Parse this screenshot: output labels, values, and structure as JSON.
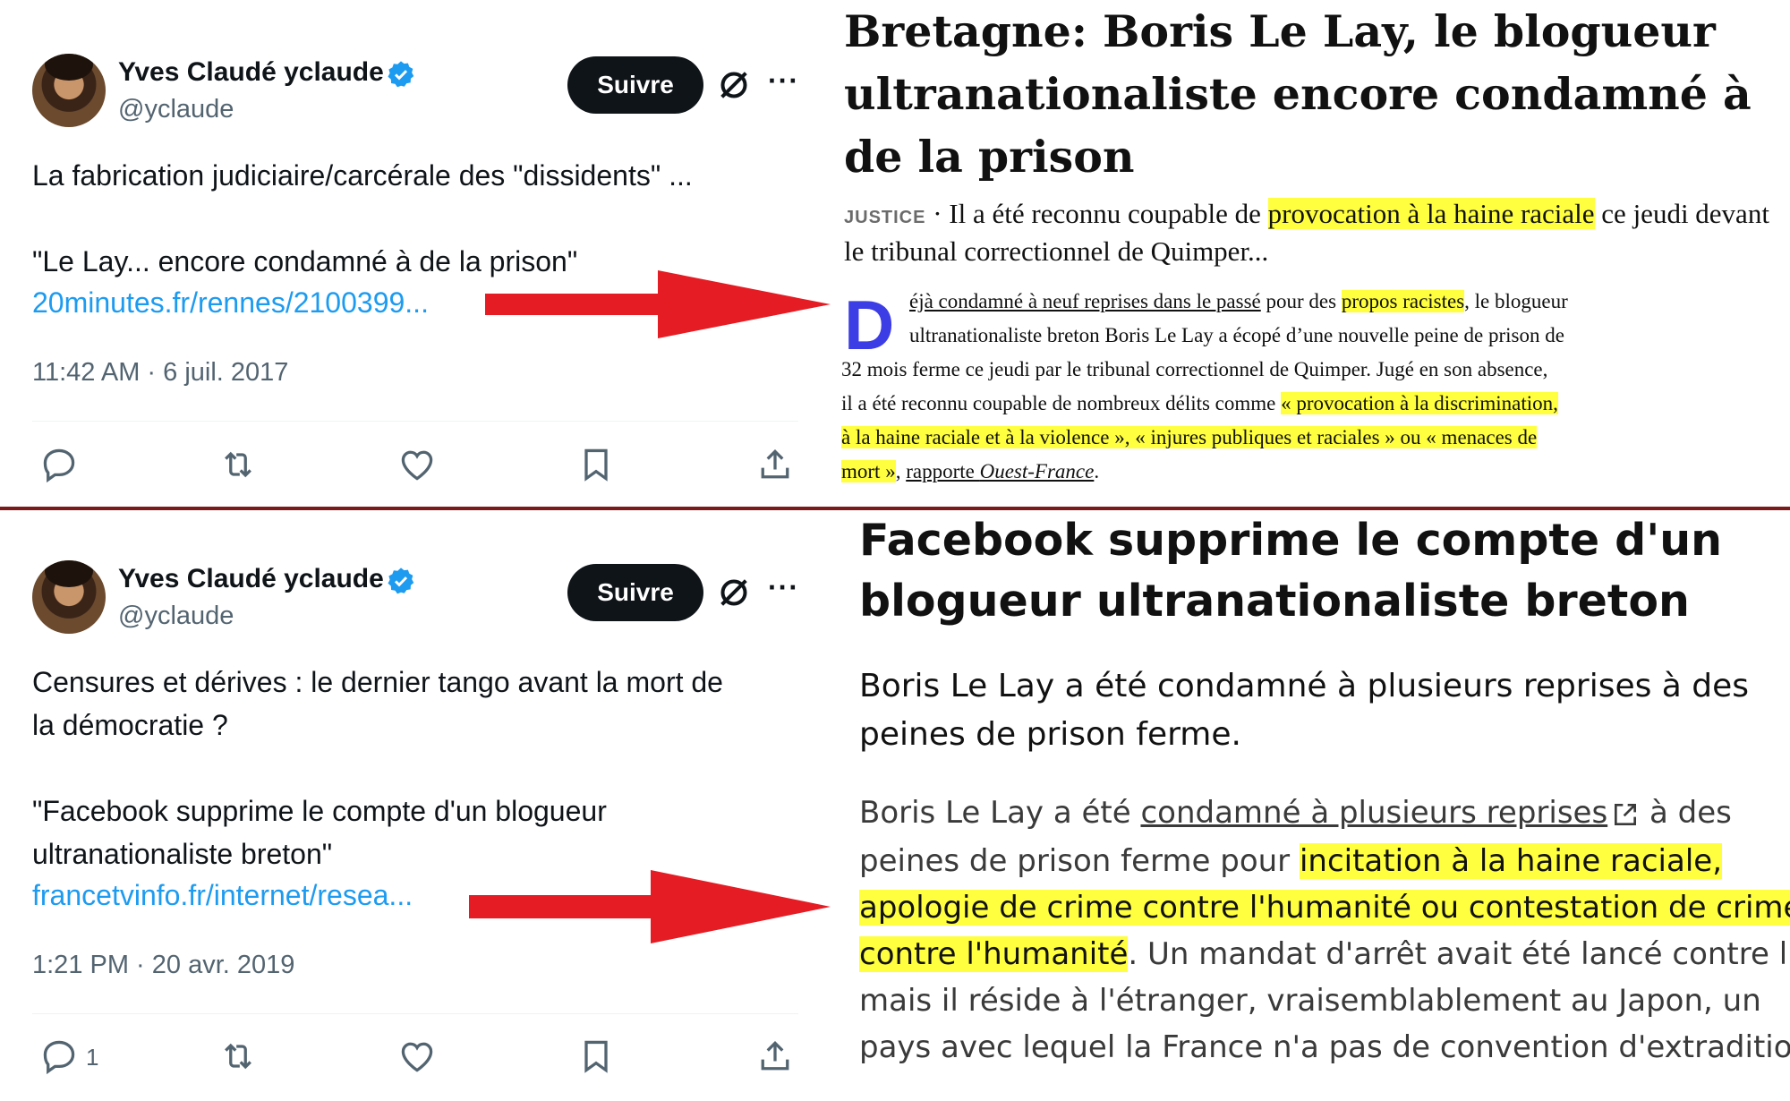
{
  "tweets": [
    {
      "name": "Yves Claudé yclaude",
      "handle": "@yclaude",
      "follow_label": "Suivre",
      "text": "La fabrication judiciaire/carcérale des \"dissidents\" ...\n\n\"Le Lay... encore condamné à de la prison\"",
      "link": "20minutes.fr/rennes/2100399...",
      "date": "11:42 AM · 6 juil. 2017",
      "reply_count": ""
    },
    {
      "name": "Yves Claudé yclaude",
      "handle": "@yclaude",
      "follow_label": "Suivre",
      "text": "Censures et dérives : le dernier tango avant la mort de\nla démocratie ?\n\n\"Facebook supprime le compte d'un blogueur\nultranationaliste breton\"",
      "link": "francetvinfo.fr/internet/resea...",
      "date": "1:21 PM · 20 avr. 2019",
      "reply_count": "1"
    }
  ],
  "article1": {
    "title": "Bretagne: Boris Le Lay, le blogueur ultranationaliste encore condamné à de la prison",
    "rubric": "JUSTICE",
    "chapo_before": " · Il a été reconnu coupable de ",
    "chapo_highlight": "provocation à la haine raciale",
    "chapo_after": " ce jeudi devant le tribunal correctionnel de Quimper...",
    "dropcap": "D",
    "l1_link": "éjà condamné à neuf reprises dans le passé",
    "l1_mid": " pour des ",
    "l1_hl": "propos racistes",
    "l1_end": ", le blogueur",
    "l2": "ultranationaliste breton Boris Le Lay a écopé d’une nouvelle peine de prison de",
    "l3": "32 mois ferme ce jeudi par le tribunal correctionnel de Quimper. Jugé en son absence,",
    "l4_start": "il a été reconnu coupable de nombreux délits comme ",
    "l4_hl": "« provocation à la discrimination,",
    "l5_hl": "à la haine raciale et à la violence », « injures publiques et raciales » ou « menaces de",
    "l6_hl": "mort »",
    "l6_sep": ", ",
    "l6_link": "rapporte ",
    "l6_source": "Ouest-France",
    "l6_end": "."
  },
  "article2": {
    "title": "Facebook supprime le compte d'un blogueur ultranationaliste breton",
    "chapo": "Boris Le Lay a été condamné à plusieurs reprises à des peines de prison ferme.",
    "l1_start": "Boris Le Lay a été ",
    "l1_link": "condamné à plusieurs reprises",
    "l1_end": " à des",
    "l2_start": "peines de prison ferme pour ",
    "l2_hl": "incitation à la haine raciale,",
    "l3_hl": "apologie de crime contre l'humanité ou contestation de crime",
    "l4_hl": "contre l'humanité",
    "l4_end": ". Un mandat d'arrêt avait été lancé contre lui,",
    "l5": "mais il réside à l'étranger, vraisemblablement au Japon, un",
    "l6": "pays avec lequel la France n'a pas de convention d'extradition."
  },
  "colors": {
    "highlight": "#ffff3f",
    "link": "#1d9bf0",
    "arrow": "#e51c23",
    "verified": "#1d9bf0",
    "dropcap": "#3d3de6"
  }
}
